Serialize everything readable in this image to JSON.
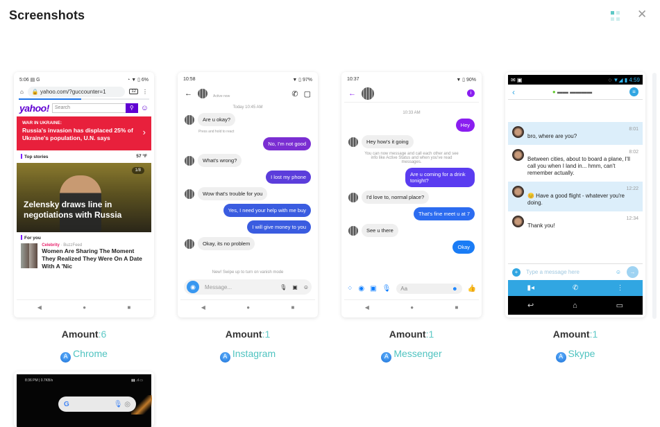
{
  "header": {
    "title": "Screenshots",
    "close_symbol": "✕"
  },
  "cards": [
    {
      "app": "Chrome",
      "amount_label": "Amount",
      "amount_sep": ":",
      "amount": "6",
      "screen": {
        "status_time": "5:06",
        "status_left": "▤ G",
        "status_right": "◔ ▼ ▯ 6%",
        "url": "yahoo.com/?guccounter=1",
        "tabs_count": "12",
        "logo": "yahoo!",
        "search_placeholder": "Search",
        "banner_kicker": "WAR IN UKRAINE:",
        "banner_headline": "Russia's invasion has displaced 25% of Ukraine's population, U.N. says",
        "top_stories": "Top stories",
        "weather": "57 °F",
        "hero_badge": "1/8",
        "hero_caption": "Zelensky draws line in negotiations with Russia",
        "for_you": "For you",
        "story_category": "Celebrity",
        "story_source": "· BuzzFeed",
        "story_title": "Women Are Sharing The Moment They Realized They Were On A Date With A 'Nic"
      }
    },
    {
      "app": "Instagram",
      "amount_label": "Amount",
      "amount_sep": ":",
      "amount": "1",
      "screen": {
        "status_time": "10:58",
        "status_right": "▼ ▯ 97%",
        "active": "Active now",
        "timestamp": "Today 10:45 AM",
        "messages": [
          {
            "dir": "in",
            "text": "Are u okay?"
          },
          {
            "dir": "out",
            "text": "No, I'm not good",
            "color": "#7a2ed2"
          },
          {
            "dir": "in",
            "text": "What's wrong?"
          },
          {
            "dir": "out",
            "text": "I lost my phone",
            "color": "#5b3ddb"
          },
          {
            "dir": "in",
            "text": "Wow that's trouble for you"
          },
          {
            "dir": "out",
            "text": "Yes, I need your help with me buy",
            "color": "#3a5ce0"
          },
          {
            "dir": "out",
            "text": "I will give money to you",
            "color": "#3a5ce0"
          },
          {
            "dir": "in",
            "text": "Okay, its no problem"
          }
        ],
        "react_hint": "Press and hold to react",
        "vanish_hint": "New! Swipe up to turn on vanish mode",
        "message_placeholder": "Message..."
      }
    },
    {
      "app": "Messenger",
      "amount_label": "Amount",
      "amount_sep": ":",
      "amount": "1",
      "screen": {
        "status_time": "10:37",
        "status_right": "▼ ▯ 90%",
        "timestamp": "10:33 AM",
        "messages": [
          {
            "dir": "out",
            "text": "Hey",
            "color": "#8a1ef0"
          },
          {
            "dir": "in",
            "text": "Hey how's it going"
          },
          {
            "dir": "out",
            "text": "Are u coming for a drink tonight?",
            "color": "#5a3cf0"
          },
          {
            "dir": "in",
            "text": "I'd love to, normal place?"
          },
          {
            "dir": "out",
            "text": "That's fine meet u at 7",
            "color": "#2c6cf0"
          },
          {
            "dir": "in",
            "text": "See u there"
          },
          {
            "dir": "out",
            "text": "Okay",
            "color": "#1a7cf5"
          }
        ],
        "info_note": "You can now message and call each other and see info like Active Status and when you've read messages.",
        "input_placeholder": "Aa"
      }
    },
    {
      "app": "Skype",
      "amount_label": "Amount",
      "amount_sep": ":",
      "amount": "1",
      "screen": {
        "status_time": "4:59",
        "messages": [
          {
            "time": "8:01",
            "text": "bro, where are you?",
            "highlight": true
          },
          {
            "time": "8:02",
            "text": "Between cities, about to board a plane, I'll call you when I land in... hmm, can't remember actually.",
            "highlight": false
          },
          {
            "time": "12:22",
            "text": "😊 Have a good flight - whatever you're doing.",
            "highlight": true
          },
          {
            "time": "12:34",
            "text": "Thank you!",
            "highlight": false
          }
        ],
        "input_placeholder": "Type a message here"
      }
    }
  ],
  "fifth_card": {
    "status_left": "8:36 PM | 0.7KB/s",
    "status_right": "▮▮ .ıl ▭"
  },
  "icons": {
    "app_store": "A"
  }
}
